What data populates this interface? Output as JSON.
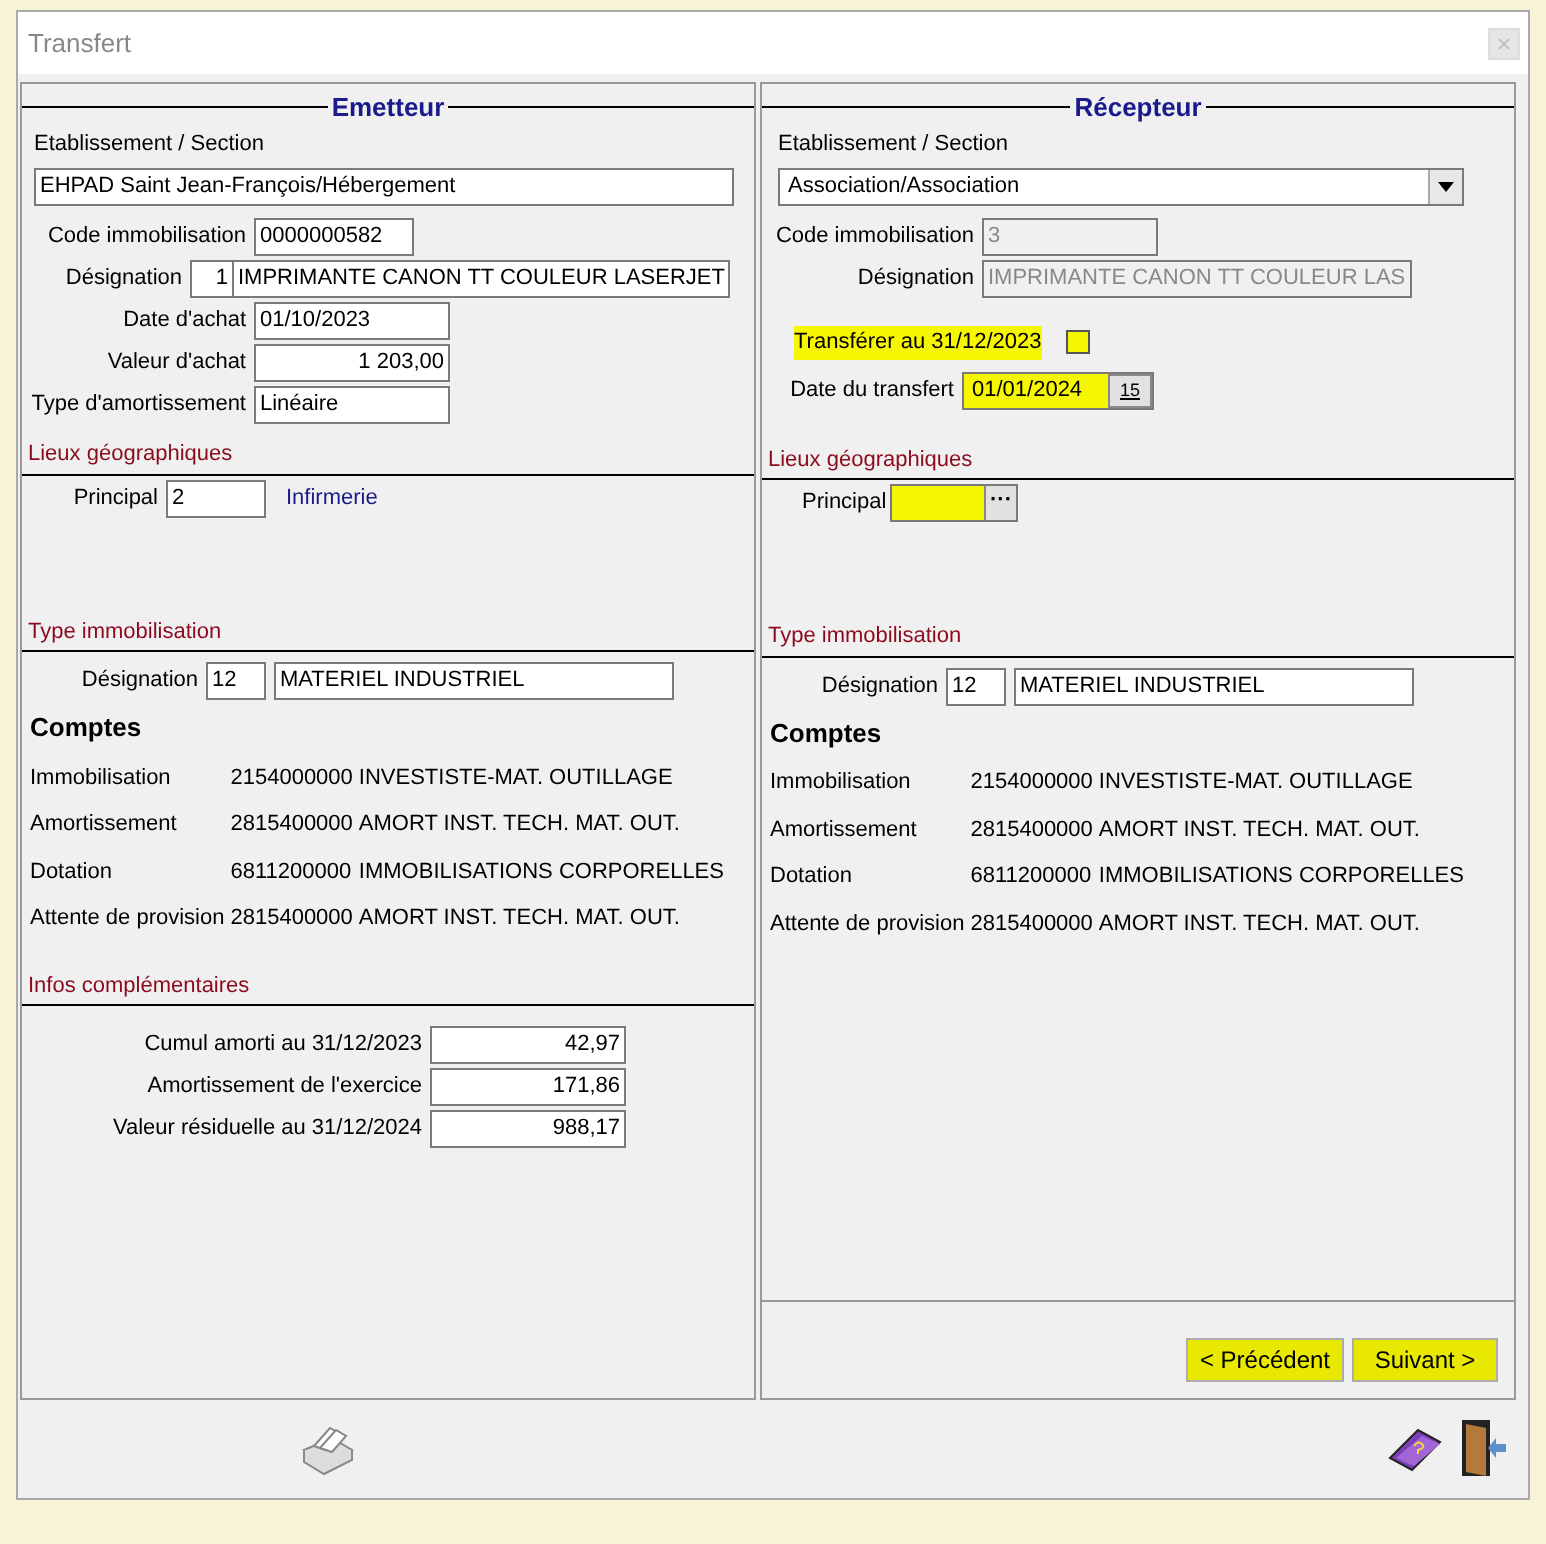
{
  "window": {
    "title": "Transfert"
  },
  "emetteur": {
    "title": "Emetteur",
    "etablissement_label": "Etablissement / Section",
    "etablissement": "EHPAD Saint Jean-François/Hébergement",
    "code_label": "Code immobilisation",
    "code": "0000000582",
    "designation_label": "Désignation",
    "designation_number": "1",
    "designation": "IMPRIMANTE CANON TT COULEUR LASERJET",
    "date_label": "Date d'achat",
    "date": "01/10/2023",
    "valeur_label": "Valeur d'achat",
    "valeur": "1 203,00",
    "type_label": "Type d'amortissement",
    "type": "Linéaire",
    "lieux_title": "Lieux géographiques",
    "principal_label": "Principal",
    "principal_code": "2",
    "principal_name": "Infirmerie",
    "type_immo_title": "Type immobilisation",
    "type_designation_label": "Désignation",
    "type_code": "12",
    "type_name": "MATERIEL INDUSTRIEL",
    "comptes_title": "Comptes",
    "comptes": [
      {
        "label": "Immobilisation",
        "account": "2154000000",
        "name": "INVESTISTE-MAT. OUTILLAGE"
      },
      {
        "label": "Amortissement",
        "account": "2815400000",
        "name": "AMORT INST. TECH. MAT. OUT."
      },
      {
        "label": "Dotation",
        "account": "6811200000",
        "name": "IMMOBILISATIONS CORPORELLES"
      },
      {
        "label": "Attente de provision",
        "account": "2815400000",
        "name": "AMORT INST. TECH. MAT. OUT."
      }
    ],
    "infos_title": "Infos complémentaires",
    "infos": [
      {
        "label": "Cumul amorti au 31/12/2023",
        "value": "42,97"
      },
      {
        "label": "Amortissement de l'exercice",
        "value": "171,86"
      },
      {
        "label": "Valeur résiduelle au 31/12/2024",
        "value": "988,17"
      }
    ]
  },
  "recepteur": {
    "title": "Récepteur",
    "etablissement_label": "Etablissement / Section",
    "etablissement": "Association/Association",
    "code_label": "Code immobilisation",
    "code": "3",
    "code_disabled": true,
    "designation_label": "Désignation",
    "designation": "IMPRIMANTE CANON TT COULEUR LAS",
    "designation_disabled": true,
    "transfer_label": "Transférer au 31/12/2023",
    "transfer_checked": false,
    "transfer_highlighted": true,
    "date_label": "Date du transfert",
    "date": "01/01/2024",
    "date_highlighted": true,
    "calendar_button": "15",
    "lieux_title": "Lieux géographiques",
    "principal_label": "Principal",
    "principal_highlighted": true,
    "browse_button": "···",
    "type_immo_title": "Type immobilisation",
    "type_designation_label": "Désignation",
    "type_code": "12",
    "type_name": "MATERIEL INDUSTRIEL",
    "comptes_title": "Comptes",
    "comptes": [
      {
        "label": "Immobilisation",
        "account": "2154000000",
        "name": "INVESTISTE-MAT. OUTILLAGE"
      },
      {
        "label": "Amortissement",
        "account": "2815400000",
        "name": "AMORT INST. TECH. MAT. OUT."
      },
      {
        "label": "Dotation",
        "account": "6811200000",
        "name": "IMMOBILISATIONS CORPORELLES"
      },
      {
        "label": "Attente de provision",
        "account": "2815400000",
        "name": "AMORT INST. TECH. MAT. OUT."
      }
    ]
  },
  "buttons": [
    {
      "label": "< Précédent",
      "highlighted": true
    },
    {
      "label": "Suivant >",
      "highlighted": true
    }
  ]
}
